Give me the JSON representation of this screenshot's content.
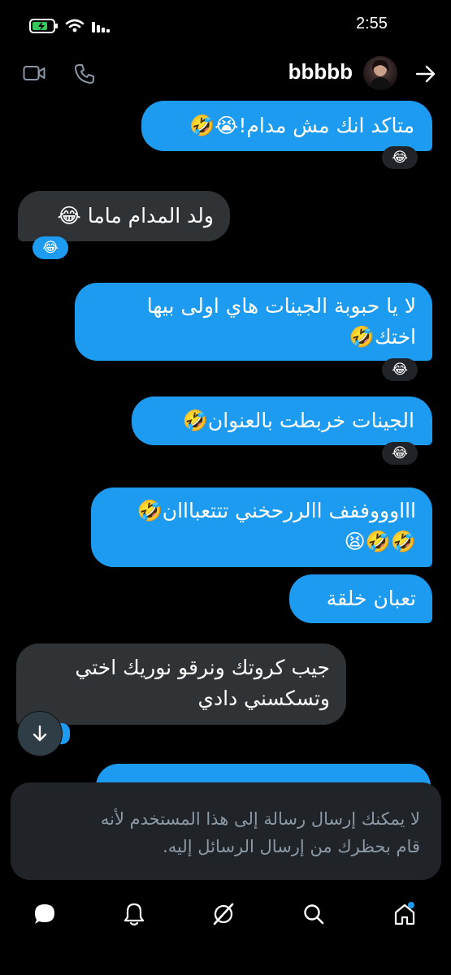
{
  "status_bar": {
    "time": "2:55"
  },
  "header": {
    "username": "bbbbb"
  },
  "messages": [
    {
      "text": "متاكد انك مش مدام!😭🤣",
      "reaction": "😂"
    },
    {
      "text": "ولد المدام ماما 😂",
      "reaction": "😂"
    },
    {
      "line1": "لا يا حبوبة الجينات هاي اولى بيها",
      "line2": "اختك🤣",
      "reaction": "😂"
    },
    {
      "text": "الجينات خربطت بالعنوان🤣",
      "reaction": "😂"
    },
    {
      "line1": "اااوووففف االررحخني تتتعبااان🤣",
      "line2": "🤣🤣😫"
    },
    {
      "text": "تعبان خلقة"
    },
    {
      "line1": "جيب كروتك ونرقو نوريك اختي",
      "line2": "وتسكسني دادي"
    }
  ],
  "blocked_notice": {
    "line1": "لا يمكنك إرسال رسالة إلى هذا المستخدم لأنه",
    "line2": "قام بحظرك من إرسال الرسائل إليه."
  },
  "colors": {
    "outgoing": "#1d9bf0",
    "incoming": "#2f3336",
    "background": "#000000"
  },
  "icons": [
    "video-icon",
    "phone-icon",
    "back-arrow-icon",
    "scroll-down-icon",
    "messages-icon",
    "notifications-icon",
    "grok-icon",
    "search-icon",
    "home-icon"
  ]
}
